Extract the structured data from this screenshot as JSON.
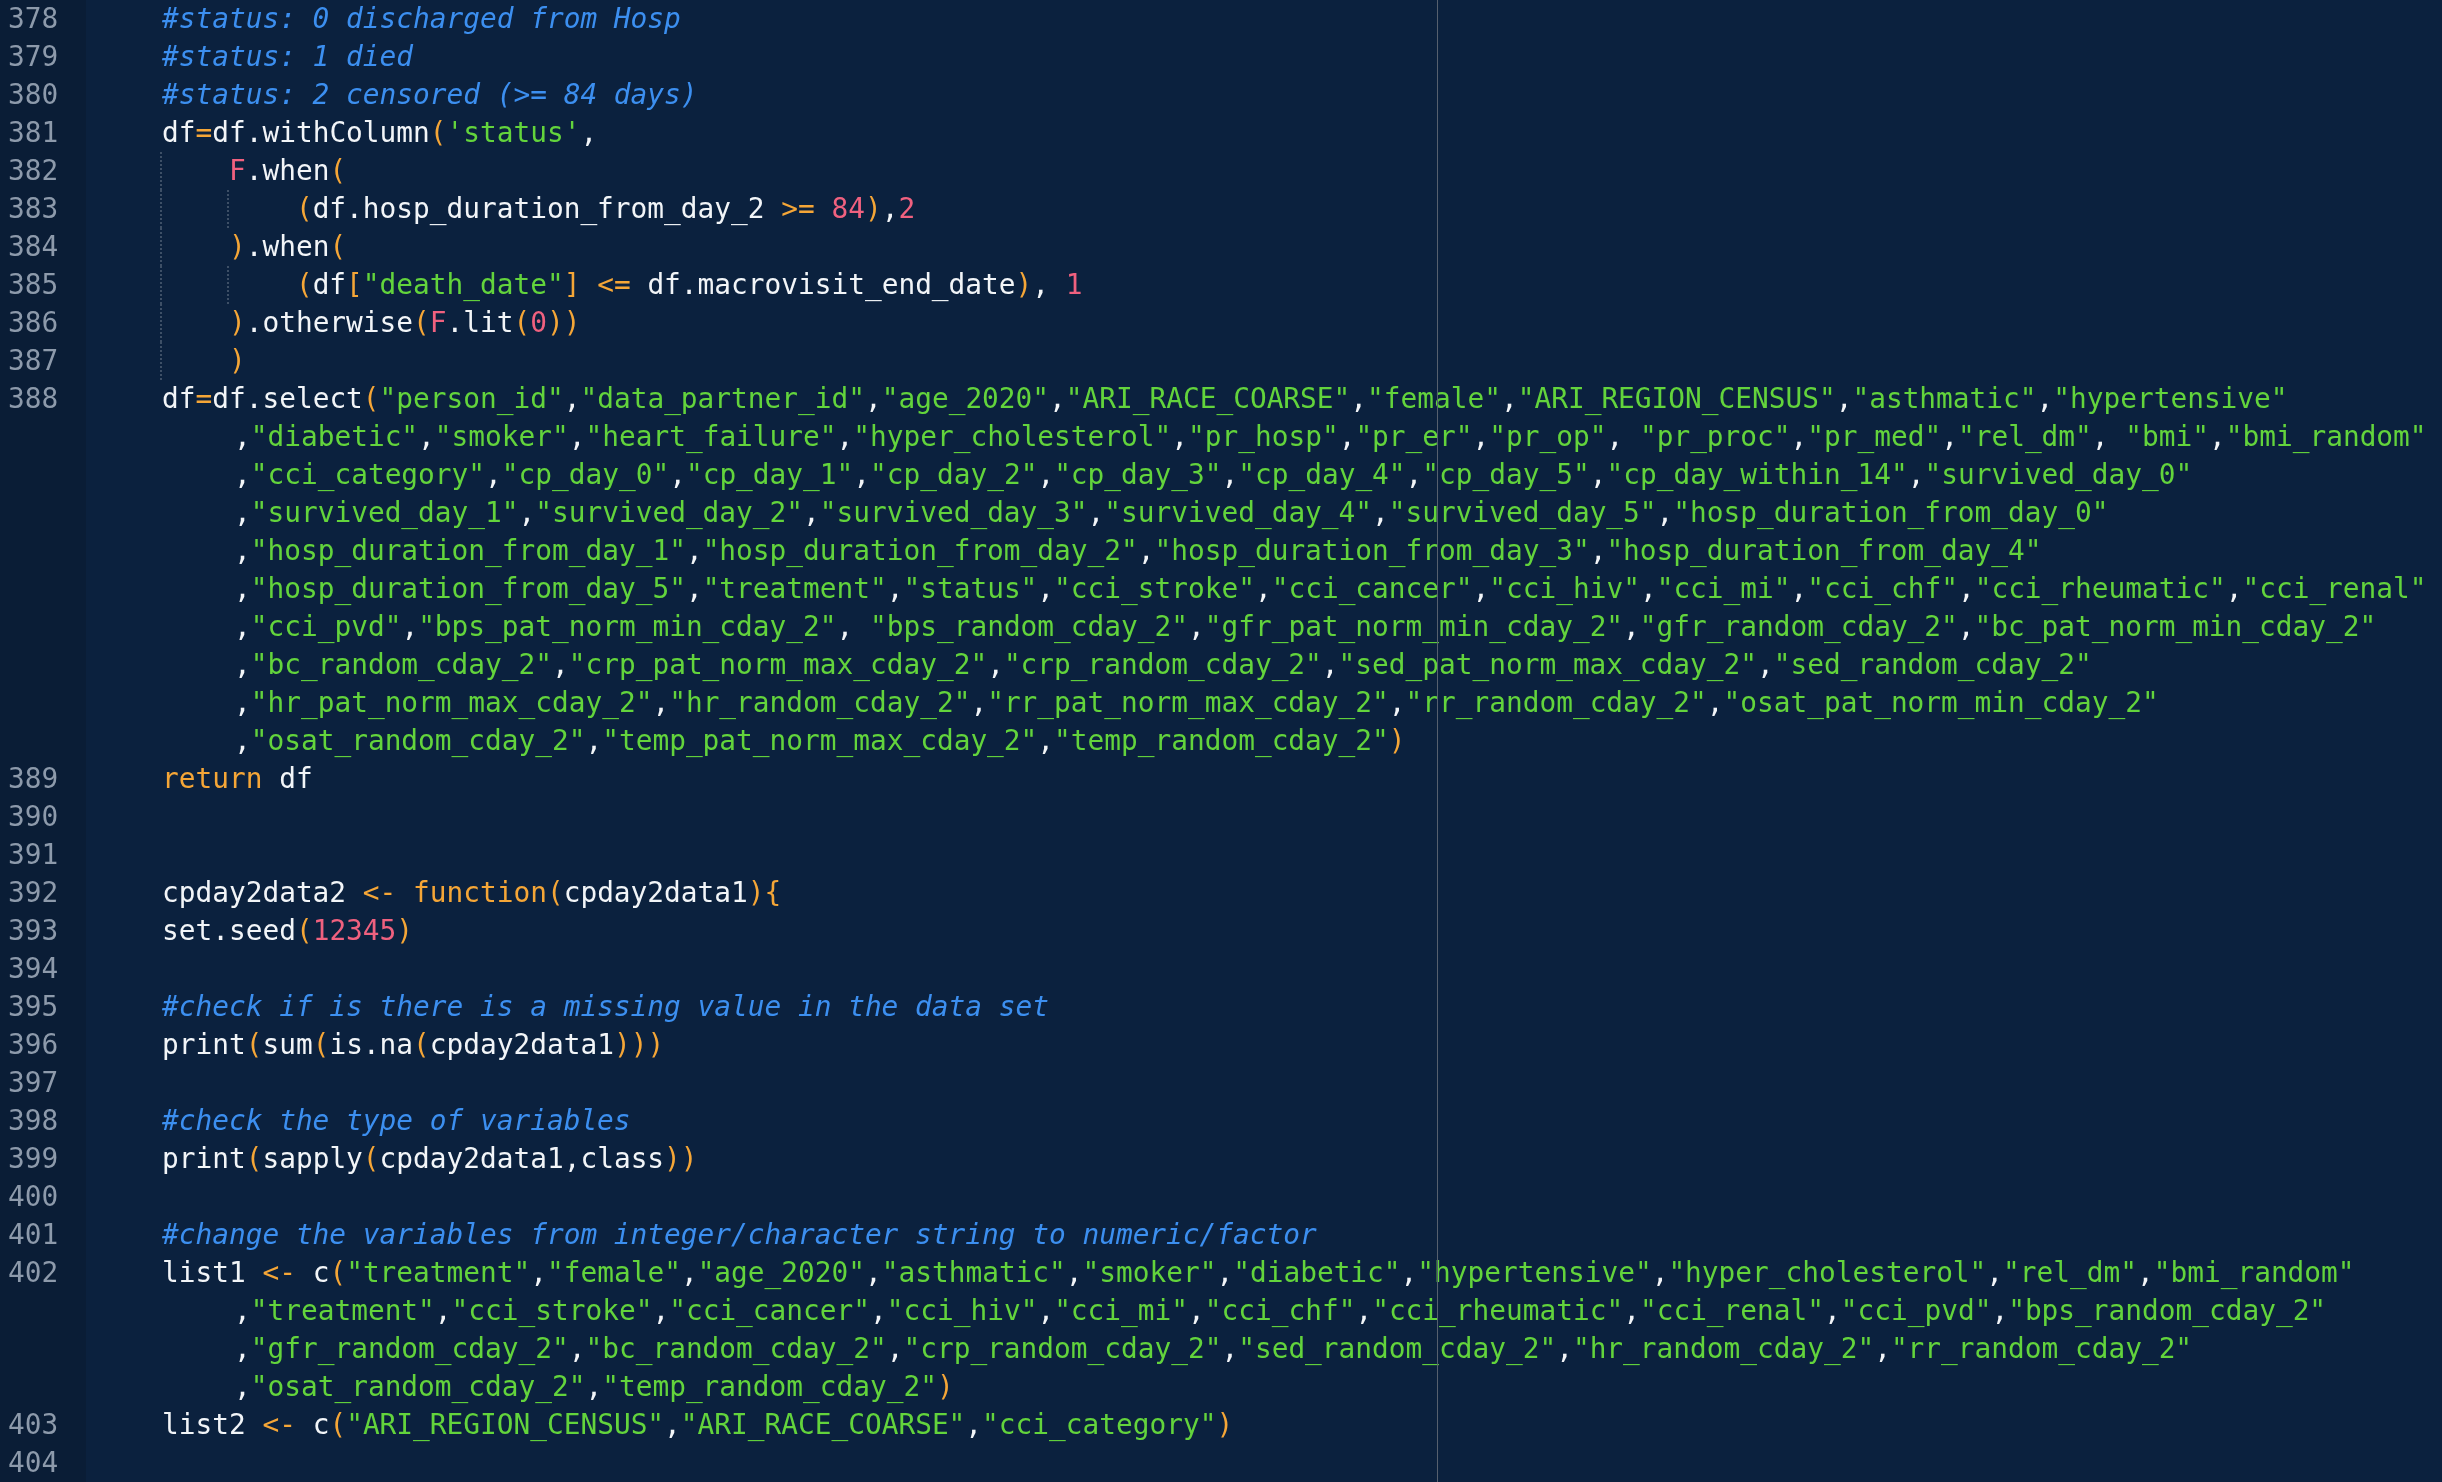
{
  "editor": {
    "rows": [
      {
        "number": "378",
        "tokens": [
          {
            "kind": "comment",
            "text": "#status: 0 discharged from Hosp"
          }
        ]
      },
      {
        "number": "379",
        "tokens": [
          {
            "kind": "comment",
            "text": "#status: 1 died"
          }
        ]
      },
      {
        "number": "380",
        "tokens": [
          {
            "kind": "comment",
            "text": "#status: 2 censored (>= 84 days)"
          }
        ]
      },
      {
        "number": "381",
        "tokens": [
          {
            "kind": "plain",
            "text": "df"
          },
          {
            "kind": "keyword",
            "text": "="
          },
          {
            "kind": "plain",
            "text": "df.withColumn"
          },
          {
            "kind": "keyword",
            "text": "("
          },
          {
            "kind": "string",
            "text": "'status'"
          },
          {
            "kind": "plain",
            "text": ","
          }
        ]
      },
      {
        "number": "382",
        "tokens": [
          {
            "kind": "indent"
          },
          {
            "kind": "constant",
            "text": "F"
          },
          {
            "kind": "plain",
            "text": ".when"
          },
          {
            "kind": "keyword",
            "text": "("
          }
        ]
      },
      {
        "number": "383",
        "tokens": [
          {
            "kind": "indent"
          },
          {
            "kind": "indent"
          },
          {
            "kind": "keyword",
            "text": "("
          },
          {
            "kind": "plain",
            "text": "df.hosp_duration_from_day_2 "
          },
          {
            "kind": "keyword",
            "text": ">= "
          },
          {
            "kind": "constant",
            "text": "84"
          },
          {
            "kind": "keyword",
            "text": ")"
          },
          {
            "kind": "plain",
            "text": ","
          },
          {
            "kind": "constant",
            "text": "2"
          }
        ]
      },
      {
        "number": "384",
        "tokens": [
          {
            "kind": "indent"
          },
          {
            "kind": "keyword",
            "text": ")"
          },
          {
            "kind": "plain",
            "text": ".when"
          },
          {
            "kind": "keyword",
            "text": "("
          }
        ]
      },
      {
        "number": "385",
        "tokens": [
          {
            "kind": "indent"
          },
          {
            "kind": "indent"
          },
          {
            "kind": "keyword",
            "text": "("
          },
          {
            "kind": "plain",
            "text": "df"
          },
          {
            "kind": "keyword",
            "text": "["
          },
          {
            "kind": "string",
            "text": "\"death_date\""
          },
          {
            "kind": "keyword",
            "text": "] <="
          },
          {
            "kind": "plain",
            "text": " df.macrovisit_end_date"
          },
          {
            "kind": "keyword",
            "text": ")"
          },
          {
            "kind": "plain",
            "text": ", "
          },
          {
            "kind": "constant",
            "text": "1"
          }
        ]
      },
      {
        "number": "386",
        "tokens": [
          {
            "kind": "indent"
          },
          {
            "kind": "keyword",
            "text": ")"
          },
          {
            "kind": "plain",
            "text": ".otherwise"
          },
          {
            "kind": "keyword",
            "text": "("
          },
          {
            "kind": "constant",
            "text": "F"
          },
          {
            "kind": "plain",
            "text": ".lit"
          },
          {
            "kind": "keyword",
            "text": "("
          },
          {
            "kind": "constant",
            "text": "0"
          },
          {
            "kind": "keyword",
            "text": "))"
          }
        ]
      },
      {
        "number": "387",
        "tokens": [
          {
            "kind": "indent"
          },
          {
            "kind": "keyword",
            "text": ")"
          }
        ]
      },
      {
        "number": "388",
        "tokens": [
          {
            "kind": "plain",
            "text": "df"
          },
          {
            "kind": "keyword",
            "text": "="
          },
          {
            "kind": "plain",
            "text": "df.select"
          },
          {
            "kind": "keyword",
            "text": "("
          },
          {
            "kind": "string",
            "text": "\"person_id\""
          },
          {
            "kind": "plain",
            "text": ","
          },
          {
            "kind": "string",
            "text": "\"data_partner_id\""
          },
          {
            "kind": "plain",
            "text": ","
          },
          {
            "kind": "string",
            "text": "\"age_2020\""
          },
          {
            "kind": "plain",
            "text": ","
          },
          {
            "kind": "string",
            "text": "\"ARI_RACE_COARSE\""
          },
          {
            "kind": "plain",
            "text": ","
          },
          {
            "kind": "string",
            "text": "\"female\""
          },
          {
            "kind": "plain",
            "text": ","
          },
          {
            "kind": "string",
            "text": "\"ARI_REGION_CENSUS\""
          },
          {
            "kind": "plain",
            "text": ","
          },
          {
            "kind": "string",
            "text": "\"asthmatic\""
          },
          {
            "kind": "plain",
            "text": ","
          },
          {
            "kind": "string",
            "text": "\"hypertensive\""
          }
        ],
        "continuation": [
          {
            "lead": ",",
            "tokens": [
              {
                "kind": "string",
                "text": "\"diabetic\"",
                "after": ","
              },
              {
                "kind": "string",
                "text": "\"smoker\"",
                "after": ","
              },
              {
                "kind": "string",
                "text": "\"heart_failure\"",
                "after": ","
              },
              {
                "kind": "string",
                "text": "\"hyper_cholesterol\"",
                "after": ","
              },
              {
                "kind": "string",
                "text": "\"pr_hosp\"",
                "after": ","
              },
              {
                "kind": "string",
                "text": "\"pr_er\"",
                "after": ","
              },
              {
                "kind": "string",
                "text": "\"pr_op\"",
                "after": ", "
              },
              {
                "kind": "string",
                "text": "\"pr_proc\"",
                "after": ","
              },
              {
                "kind": "string",
                "text": "\"pr_med\"",
                "after": ","
              },
              {
                "kind": "string",
                "text": "\"rel_dm\"",
                "after": ", "
              },
              {
                "kind": "string",
                "text": "\"bmi\"",
                "after": ","
              },
              {
                "kind": "string",
                "text": "\"bmi_random\""
              }
            ]
          },
          {
            "lead": ",",
            "tokens": [
              {
                "kind": "string",
                "text": "\"cci_category\"",
                "after": ","
              },
              {
                "kind": "string",
                "text": "\"cp_day_0\"",
                "after": ","
              },
              {
                "kind": "string",
                "text": "\"cp_day_1\"",
                "after": ","
              },
              {
                "kind": "string",
                "text": "\"cp_day_2\"",
                "after": ","
              },
              {
                "kind": "string",
                "text": "\"cp_day_3\"",
                "after": ","
              },
              {
                "kind": "string",
                "text": "\"cp_day_4\"",
                "after": ","
              },
              {
                "kind": "string",
                "text": "\"cp_day_5\"",
                "after": ","
              },
              {
                "kind": "string",
                "text": "\"cp_day_within_14\"",
                "after": ","
              },
              {
                "kind": "string",
                "text": "\"survived_day_0\""
              }
            ]
          },
          {
            "lead": ",",
            "tokens": [
              {
                "kind": "string",
                "text": "\"survived_day_1\"",
                "after": ","
              },
              {
                "kind": "string",
                "text": "\"survived_day_2\"",
                "after": ","
              },
              {
                "kind": "string",
                "text": "\"survived_day_3\"",
                "after": ","
              },
              {
                "kind": "string",
                "text": "\"survived_day_4\"",
                "after": ","
              },
              {
                "kind": "string",
                "text": "\"survived_day_5\"",
                "after": ","
              },
              {
                "kind": "string",
                "text": "\"hosp_duration_from_day_0\""
              }
            ]
          },
          {
            "lead": ",",
            "tokens": [
              {
                "kind": "string",
                "text": "\"hosp_duration_from_day_1\"",
                "after": ","
              },
              {
                "kind": "string",
                "text": "\"hosp_duration_from_day_2\"",
                "after": ","
              },
              {
                "kind": "string",
                "text": "\"hosp_duration_from_day_3\"",
                "after": ","
              },
              {
                "kind": "string",
                "text": "\"hosp_duration_from_day_4\""
              }
            ]
          },
          {
            "lead": ",",
            "tokens": [
              {
                "kind": "string",
                "text": "\"hosp_duration_from_day_5\"",
                "after": ","
              },
              {
                "kind": "string",
                "text": "\"treatment\"",
                "after": ","
              },
              {
                "kind": "string",
                "text": "\"status\"",
                "after": ","
              },
              {
                "kind": "string",
                "text": "\"cci_stroke\"",
                "after": ","
              },
              {
                "kind": "string",
                "text": "\"cci_cancer\"",
                "after": ","
              },
              {
                "kind": "string",
                "text": "\"cci_hiv\"",
                "after": ","
              },
              {
                "kind": "string",
                "text": "\"cci_mi\"",
                "after": ","
              },
              {
                "kind": "string",
                "text": "\"cci_chf\"",
                "after": ","
              },
              {
                "kind": "string",
                "text": "\"cci_rheumatic\"",
                "after": ","
              },
              {
                "kind": "string",
                "text": "\"cci_renal\""
              }
            ]
          },
          {
            "lead": ",",
            "tokens": [
              {
                "kind": "string",
                "text": "\"cci_pvd\"",
                "after": ","
              },
              {
                "kind": "string",
                "text": "\"bps_pat_norm_min_cday_2\"",
                "after": ", "
              },
              {
                "kind": "string",
                "text": "\"bps_random_cday_2\"",
                "after": ","
              },
              {
                "kind": "string",
                "text": "\"gfr_pat_norm_min_cday_2\"",
                "after": ","
              },
              {
                "kind": "string",
                "text": "\"gfr_random_cday_2\"",
                "after": ","
              },
              {
                "kind": "string",
                "text": "\"bc_pat_norm_min_cday_2\""
              }
            ]
          },
          {
            "lead": ",",
            "tokens": [
              {
                "kind": "string",
                "text": "\"bc_random_cday_2\"",
                "after": ","
              },
              {
                "kind": "string",
                "text": "\"crp_pat_norm_max_cday_2\"",
                "after": ","
              },
              {
                "kind": "string",
                "text": "\"crp_random_cday_2\"",
                "after": ","
              },
              {
                "kind": "string",
                "text": "\"sed_pat_norm_max_cday_2\"",
                "after": ","
              },
              {
                "kind": "string",
                "text": "\"sed_random_cday_2\""
              }
            ]
          },
          {
            "lead": ",",
            "tokens": [
              {
                "kind": "string",
                "text": "\"hr_pat_norm_max_cday_2\"",
                "after": ","
              },
              {
                "kind": "string",
                "text": "\"hr_random_cday_2\"",
                "after": ","
              },
              {
                "kind": "string",
                "text": "\"rr_pat_norm_max_cday_2\"",
                "after": ","
              },
              {
                "kind": "string",
                "text": "\"rr_random_cday_2\"",
                "after": ","
              },
              {
                "kind": "string",
                "text": "\"osat_pat_norm_min_cday_2\""
              }
            ]
          },
          {
            "lead": ",",
            "tokens": [
              {
                "kind": "string",
                "text": "\"osat_random_cday_2\"",
                "after": ","
              },
              {
                "kind": "string",
                "text": "\"temp_pat_norm_max_cday_2\"",
                "after": ","
              },
              {
                "kind": "string",
                "text": "\"temp_random_cday_2\""
              },
              {
                "kind": "keyword",
                "text": ")"
              }
            ]
          }
        ]
      },
      {
        "number": "389",
        "tokens": [
          {
            "kind": "keyword",
            "text": "return"
          },
          {
            "kind": "plain",
            "text": " df"
          }
        ]
      },
      {
        "number": "390"
      },
      {
        "number": "391"
      },
      {
        "number": "392",
        "tokens": [
          {
            "kind": "plain",
            "text": "cpday2data2 "
          },
          {
            "kind": "keyword",
            "text": "<- function("
          },
          {
            "kind": "plain",
            "text": "cpday2data1"
          },
          {
            "kind": "keyword",
            "text": "){"
          }
        ]
      },
      {
        "number": "393",
        "tokens": [
          {
            "kind": "plain",
            "text": "set.seed"
          },
          {
            "kind": "keyword",
            "text": "("
          },
          {
            "kind": "constant",
            "text": "12345"
          },
          {
            "kind": "keyword",
            "text": ")"
          }
        ]
      },
      {
        "number": "394"
      },
      {
        "number": "395",
        "tokens": [
          {
            "kind": "comment",
            "text": "#check if is there is a missing value in the data set"
          }
        ]
      },
      {
        "number": "396",
        "tokens": [
          {
            "kind": "plain",
            "text": "print"
          },
          {
            "kind": "keyword",
            "text": "("
          },
          {
            "kind": "plain",
            "text": "sum"
          },
          {
            "kind": "keyword",
            "text": "("
          },
          {
            "kind": "plain",
            "text": "is.na"
          },
          {
            "kind": "keyword",
            "text": "("
          },
          {
            "kind": "plain",
            "text": "cpday2data1"
          },
          {
            "kind": "keyword",
            "text": ")))"
          }
        ]
      },
      {
        "number": "397"
      },
      {
        "number": "398",
        "tokens": [
          {
            "kind": "comment",
            "text": "#check the type of variables"
          }
        ]
      },
      {
        "number": "399",
        "tokens": [
          {
            "kind": "plain",
            "text": "print"
          },
          {
            "kind": "keyword",
            "text": "("
          },
          {
            "kind": "plain",
            "text": "sapply"
          },
          {
            "kind": "keyword",
            "text": "("
          },
          {
            "kind": "plain",
            "text": "cpday2data1,class"
          },
          {
            "kind": "keyword",
            "text": "))"
          }
        ]
      },
      {
        "number": "400"
      },
      {
        "number": "401",
        "tokens": [
          {
            "kind": "comment",
            "text": "#change the variables from integer/character string to numeric/factor"
          }
        ]
      },
      {
        "number": "402",
        "tokens": [
          {
            "kind": "plain",
            "text": "list1 "
          },
          {
            "kind": "keyword",
            "text": "<-"
          },
          {
            "kind": "plain",
            "text": " c"
          },
          {
            "kind": "keyword",
            "text": "("
          },
          {
            "kind": "string",
            "text": "\"treatment\""
          },
          {
            "kind": "plain",
            "text": ","
          },
          {
            "kind": "string",
            "text": "\"female\""
          },
          {
            "kind": "plain",
            "text": ","
          },
          {
            "kind": "string",
            "text": "\"age_2020\""
          },
          {
            "kind": "plain",
            "text": ","
          },
          {
            "kind": "string",
            "text": "\"asthmatic\""
          },
          {
            "kind": "plain",
            "text": ","
          },
          {
            "kind": "string",
            "text": "\"smoker\""
          },
          {
            "kind": "plain",
            "text": ","
          },
          {
            "kind": "string",
            "text": "\"diabetic\""
          },
          {
            "kind": "plain",
            "text": ","
          },
          {
            "kind": "string",
            "text": "\"hypertensive\""
          },
          {
            "kind": "plain",
            "text": ","
          },
          {
            "kind": "string",
            "text": "\"hyper_cholesterol\""
          },
          {
            "kind": "plain",
            "text": ","
          },
          {
            "kind": "string",
            "text": "\"rel_dm\""
          },
          {
            "kind": "plain",
            "text": ","
          },
          {
            "kind": "string",
            "text": "\"bmi_random\""
          }
        ],
        "continuation": [
          {
            "lead": ",",
            "tokens": [
              {
                "kind": "string",
                "text": "\"treatment\"",
                "after": ","
              },
              {
                "kind": "string",
                "text": "\"cci_stroke\"",
                "after": ","
              },
              {
                "kind": "string",
                "text": "\"cci_cancer\"",
                "after": ","
              },
              {
                "kind": "string",
                "text": "\"cci_hiv\"",
                "after": ","
              },
              {
                "kind": "string",
                "text": "\"cci_mi\"",
                "after": ","
              },
              {
                "kind": "string",
                "text": "\"cci_chf\"",
                "after": ","
              },
              {
                "kind": "string",
                "text": "\"cci_rheumatic\"",
                "after": ","
              },
              {
                "kind": "string",
                "text": "\"cci_renal\"",
                "after": ","
              },
              {
                "kind": "string",
                "text": "\"cci_pvd\"",
                "after": ","
              },
              {
                "kind": "string",
                "text": "\"bps_random_cday_2\""
              }
            ]
          },
          {
            "lead": ",",
            "tokens": [
              {
                "kind": "string",
                "text": "\"gfr_random_cday_2\"",
                "after": ","
              },
              {
                "kind": "string",
                "text": "\"bc_random_cday_2\"",
                "after": ","
              },
              {
                "kind": "string",
                "text": "\"crp_random_cday_2\"",
                "after": ","
              },
              {
                "kind": "string",
                "text": "\"sed_random_cday_2\"",
                "after": ","
              },
              {
                "kind": "string",
                "text": "\"hr_random_cday_2\"",
                "after": ","
              },
              {
                "kind": "string",
                "text": "\"rr_random_cday_2\""
              }
            ]
          },
          {
            "lead": ",",
            "tokens": [
              {
                "kind": "string",
                "text": "\"osat_random_cday_2\"",
                "after": ","
              },
              {
                "kind": "string",
                "text": "\"temp_random_cday_2\""
              },
              {
                "kind": "keyword",
                "text": ")"
              }
            ]
          }
        ]
      },
      {
        "number": "403",
        "tokens": [
          {
            "kind": "plain",
            "text": "list2 "
          },
          {
            "kind": "keyword",
            "text": "<-"
          },
          {
            "kind": "plain",
            "text": " c"
          },
          {
            "kind": "keyword",
            "text": "("
          },
          {
            "kind": "string",
            "text": "\"ARI_REGION_CENSUS\""
          },
          {
            "kind": "plain",
            "text": ","
          },
          {
            "kind": "string",
            "text": "\"ARI_RACE_COARSE\""
          },
          {
            "kind": "plain",
            "text": ","
          },
          {
            "kind": "string",
            "text": "\"cci_category\""
          },
          {
            "kind": "keyword",
            "text": ")"
          }
        ]
      },
      {
        "number": "404"
      }
    ]
  }
}
